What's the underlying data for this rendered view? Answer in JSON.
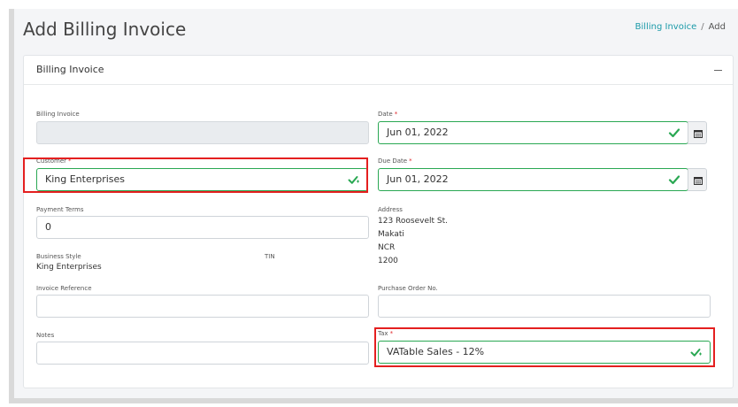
{
  "page": {
    "title": "Add Billing Invoice",
    "breadcrumb": {
      "link": "Billing Invoice",
      "separator": "/",
      "current": "Add"
    }
  },
  "card": {
    "title": "Billing Invoice"
  },
  "form": {
    "billing_invoice": {
      "label": "Billing Invoice",
      "value": ""
    },
    "date": {
      "label": "Date",
      "required": "*",
      "value": "Jun 01, 2022"
    },
    "customer": {
      "label": "Customer",
      "required": "*",
      "value": "King Enterprises"
    },
    "due_date": {
      "label": "Due Date",
      "required": "*",
      "value": "Jun 01, 2022"
    },
    "payment_terms": {
      "label": "Payment Terms",
      "value": "0"
    },
    "address": {
      "label": "Address",
      "lines": [
        "123 Roosevelt St.",
        "Makati",
        "NCR",
        "1200"
      ]
    },
    "business_style": {
      "label": "Business Style",
      "value": "King Enterprises"
    },
    "tin": {
      "label": "TIN",
      "value": ""
    },
    "invoice_reference": {
      "label": "Invoice Reference",
      "value": ""
    },
    "purchase_order_no": {
      "label": "Purchase Order No.",
      "value": ""
    },
    "notes": {
      "label": "Notes",
      "value": ""
    },
    "tax": {
      "label": "Tax",
      "required": "*",
      "value": "VATable Sales - 12%"
    }
  },
  "icons": {
    "check": "check-icon",
    "calendar": "calendar-icon",
    "collapse": "minus-icon"
  },
  "colors": {
    "accent": "#1a9aa8",
    "valid": "#2aa853",
    "required": "#e0282c",
    "highlight": "#e41f1f"
  }
}
